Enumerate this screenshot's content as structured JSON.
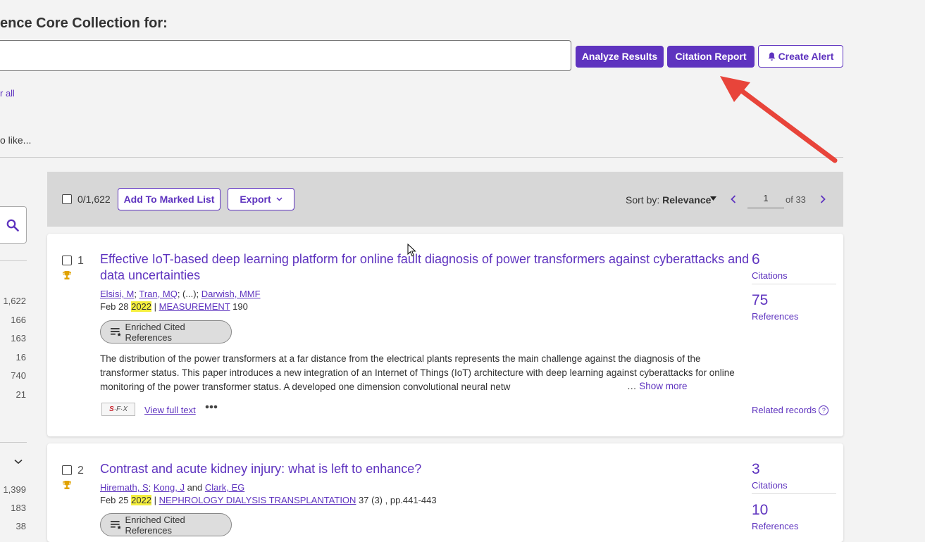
{
  "header": {
    "title": "ence Core Collection for:",
    "analyze_label": "Analyze Results",
    "citation_label": "Citation Report",
    "alert_label": "Create Alert",
    "clear_all": "r all",
    "you_like": "o like..."
  },
  "sidebar": {
    "counts_top": [
      "1,622",
      "166",
      "163",
      "16",
      "740",
      "21"
    ],
    "counts_bottom": [
      "1,399",
      "183",
      "38"
    ]
  },
  "toolbar": {
    "selected_count": "0/1,622",
    "add_marked": "Add To Marked List",
    "export": "Export",
    "sort_prefix": "Sort by: ",
    "sort_value": "Relevance",
    "page_value": "1",
    "page_of": "of 33"
  },
  "results": [
    {
      "index": "1",
      "title_line1": "Effective IoT-based deep learning platform for online fault diagnosis of power transformers against cyberattacks and",
      "title_line2": "data uncertainties",
      "author1": "Elsisi, M",
      "author2": "Tran, MQ",
      "author_mid": "; (...); ",
      "author3": "Darwish, MMF",
      "date": "Feb 28 ",
      "year": "2022",
      "journal": "MEASUREMENT",
      "volume": " 190",
      "enriched": "Enriched Cited References",
      "abstract1": "The distribution of the power transformers at a far distance from the electrical plants represents the main challenge against the diagnosis of the",
      "abstract2": "transformer status. This paper introduces a new integration of an Internet of Things (IoT) architecture with deep learning against cyberattacks for online",
      "abstract3": "monitoring of the power transformer status. A developed one dimension convolutional neural netw",
      "show_more": "Show more",
      "view_full": "View full text",
      "citations_num": "6",
      "citations_label": "Citations",
      "references_num": "75",
      "references_label": "References",
      "related": "Related records"
    },
    {
      "index": "2",
      "title_line1": "Contrast and acute kidney injury: what is left to enhance?",
      "author1": "Hiremath, S",
      "author2": "Kong, J",
      "author_and": " and ",
      "author3": "Clark, EG",
      "date": "Feb 25 ",
      "year": "2022",
      "journal": "NEPHROLOGY DIALYSIS TRANSPLANTATION",
      "volume": " 37 (3) , pp.441-443",
      "enriched": "Enriched Cited References",
      "citations_num": "3",
      "citations_label": "Citations",
      "references_num": "10",
      "references_label": "References"
    }
  ],
  "colors": {
    "accent": "#5e33bf",
    "arrow": "#e8443a",
    "highlight": "#f5ef3e"
  }
}
